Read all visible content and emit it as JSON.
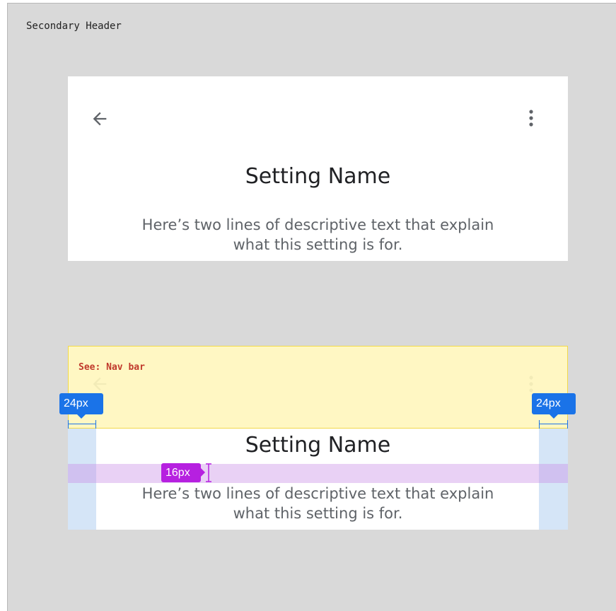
{
  "frame": {
    "title": "Secondary Header"
  },
  "header_card": {
    "setting_name": "Setting Name",
    "description_line1": "Here’s two lines of descriptive text that explain",
    "description_line2": "what this setting is for.",
    "back_icon": "arrow-back-icon",
    "menu_icon": "more-vert-icon"
  },
  "redline_card": {
    "setting_name": "Setting Name",
    "description_line1": "Here’s two lines of descriptive text that explain",
    "description_line2": "what this setting is for.",
    "nav_note": "See: Nav bar",
    "left_padding_label": "24px",
    "right_padding_label": "24px",
    "gap_label": "16px"
  },
  "colors": {
    "frame_background": "#d9d9d9",
    "nav_highlight": "#fff6be",
    "padding_highlight": "#b3cff0",
    "gap_highlight": "#c88ce6",
    "measure_blue": "#1a73e8",
    "measure_magenta": "#b620e0",
    "nav_note_text": "#c0392b"
  }
}
